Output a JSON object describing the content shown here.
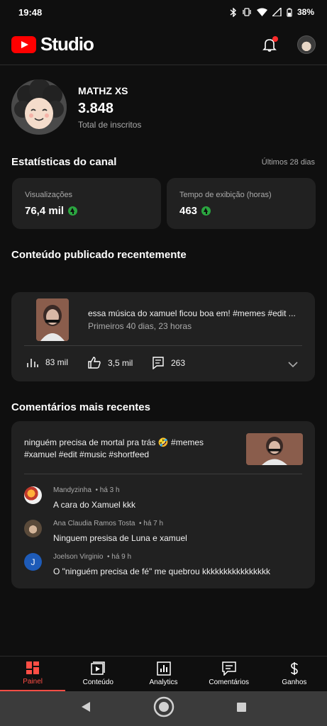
{
  "status_bar": {
    "time": "19:48",
    "battery": "38%"
  },
  "header": {
    "app_name": "Studio"
  },
  "channel": {
    "name": "MATHZ XS",
    "subscribers": "3.848",
    "subscribers_label": "Total de inscritos"
  },
  "stats": {
    "title": "Estatísticas do canal",
    "period": "Últimos 28 dias",
    "views_label": "Visualizações",
    "views_value": "76,4 mil",
    "watch_label": "Tempo de exibição (horas)",
    "watch_value": "463"
  },
  "recent_content": {
    "title": "Conteúdo publicado recentemente",
    "video_title": "essa música do xamuel ficou boa em! #memes #edit ...",
    "video_meta": "Primeiros 40 dias, 23 horas",
    "views": "83 mil",
    "likes": "3,5 mil",
    "comments": "263"
  },
  "recent_comments": {
    "title": "Comentários mais recentes",
    "video_text": "ninguém precisa de mortal pra trás 🤣 #memes #xamuel #edit #music #shortfeed",
    "items": [
      {
        "author": "Mandyzinha",
        "time": "há 3 h",
        "text": "A cara do Xamuel kkk"
      },
      {
        "author": "Ana Claudia Ramos Tosta",
        "time": "há 7 h",
        "text": "Ninguem presisa de Luna e xamuel"
      },
      {
        "author": "Joelson Virginio",
        "time": "há 9 h",
        "text": "O \"ninguém precisa de fé\" me quebrou kkkkkkkkkkkkkkkk",
        "initial": "J"
      }
    ]
  },
  "bottom_nav": [
    "Painel",
    "Conteúdo",
    "Analytics",
    "Comentários",
    "Ganhos"
  ],
  "colors": {
    "accent": "#ff4e45",
    "brand_red": "#ff0000",
    "up_green": "#2ba640",
    "card": "#212121",
    "background": "#0f0f0f"
  }
}
